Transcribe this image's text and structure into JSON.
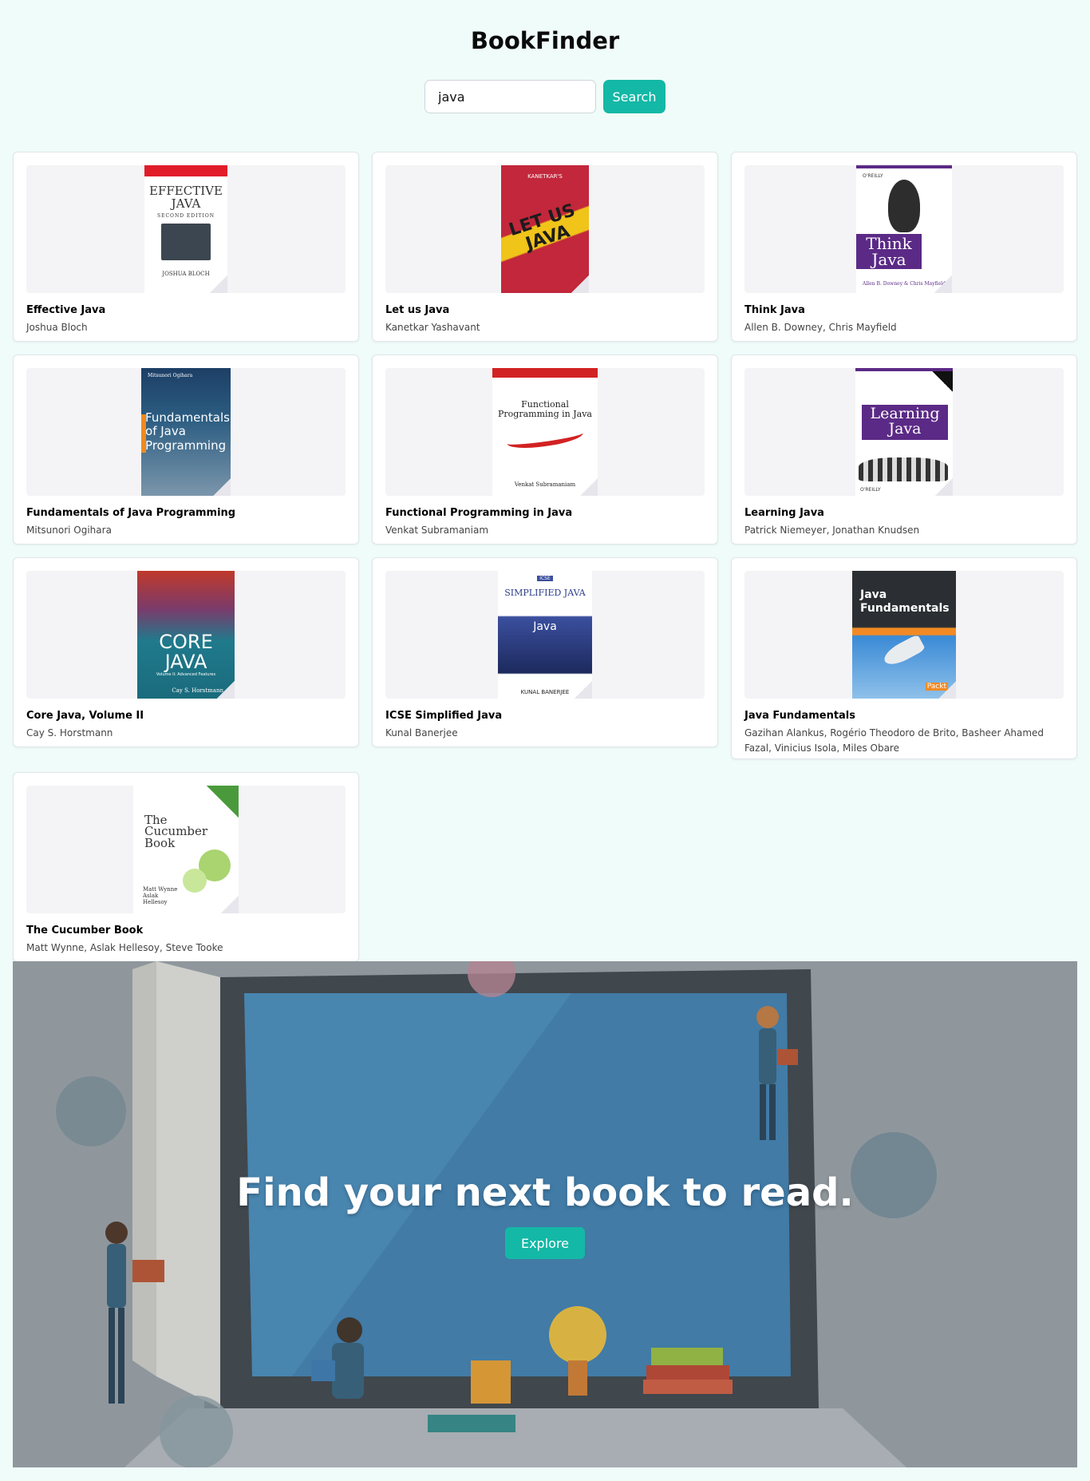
{
  "app": {
    "title": "BookFinder"
  },
  "search": {
    "value": "java",
    "button_label": "Search"
  },
  "books": [
    {
      "title": "Effective Java",
      "author": "Joshua Bloch",
      "cover": {
        "title": "EFFECTIVE JAVA",
        "subtitle": "SECOND EDITION",
        "author": "JOSHUA BLOCH",
        "bg": "#ffffff",
        "fg": "#333333",
        "accent": "#e11d2a"
      }
    },
    {
      "title": "Let us Java",
      "author": "Kanetkar Yashavant",
      "cover": {
        "title": "LET US JAVA",
        "subtitle": "KANETKAR'S",
        "author": "",
        "bg": "#c2273b",
        "fg": "#ffd21e",
        "accent": "#1c1c1c"
      }
    },
    {
      "title": "Think Java",
      "author": "Allen B. Downey, Chris Mayfield",
      "cover": {
        "title": "Think Java",
        "subtitle": "O'REILLY",
        "author": "Allen B. Downey & Chris Mayfield",
        "bg": "#ffffff",
        "fg": "#5b2a86",
        "accent": "#5b2a86"
      }
    },
    {
      "title": "Fundamentals of Java Programming",
      "author": "Mitsunori Ogihara",
      "cover": {
        "title": "Fundamentals of Java Programming",
        "subtitle": "Mitsunori Ogihara",
        "author": "",
        "bg": "#2c5d82",
        "fg": "#ffffff",
        "accent": "#f08a1c"
      }
    },
    {
      "title": "Functional Programming in Java",
      "author": "Venkat Subramaniam",
      "cover": {
        "title": "Functional Programming in Java",
        "subtitle": "",
        "author": "Venkat Subramaniam",
        "bg": "#ffffff",
        "fg": "#222222",
        "accent": "#d22222"
      }
    },
    {
      "title": "Learning Java",
      "author": "Patrick Niemeyer, Jonathan Knudsen",
      "cover": {
        "title": "Learning Java",
        "subtitle": "O'REILLY",
        "author": "",
        "bg": "#ffffff",
        "fg": "#ffffff",
        "accent": "#5b2a86"
      }
    },
    {
      "title": "Core Java, Volume II",
      "author": "Cay S. Horstmann",
      "cover": {
        "title": "CORE JAVA",
        "subtitle": "Volume II: Advanced Features",
        "author": "Cay S. Horstmann",
        "bg": "#1f7a8c",
        "fg": "#ffffff",
        "accent": "#c0392b"
      }
    },
    {
      "title": "ICSE Simplified Java",
      "author": "Kunal Banerjee",
      "cover": {
        "title": "SIMPLIFIED JAVA",
        "subtitle": "ICSE",
        "author": "KUNAL BANERJEE",
        "bg": "#ffffff",
        "fg": "#2b3c8a",
        "accent": "#3b4f9e"
      }
    },
    {
      "title": "Java Fundamentals",
      "author": "Gazihan Alankus, Rogério Theodoro de Brito, Basheer Ahamed Fazal, Vinicius Isola, Miles Obare",
      "cover": {
        "title": "Java Fundamentals",
        "subtitle": "Packt",
        "author": "",
        "bg": "#2b2f33",
        "fg": "#ffffff",
        "accent": "#f28a24"
      }
    },
    {
      "title": "The Cucumber Book",
      "author": "Matt Wynne, Aslak Hellesoy, Steve Tooke",
      "cover": {
        "title": "The Cucumber Book",
        "subtitle": "",
        "author": "Matt Wynne Aslak Hellesoy",
        "bg": "#ffffff",
        "fg": "#333333",
        "accent": "#4a9a3c"
      }
    }
  ],
  "hero": {
    "title": "Find your next book to read.",
    "button_label": "Explore"
  }
}
